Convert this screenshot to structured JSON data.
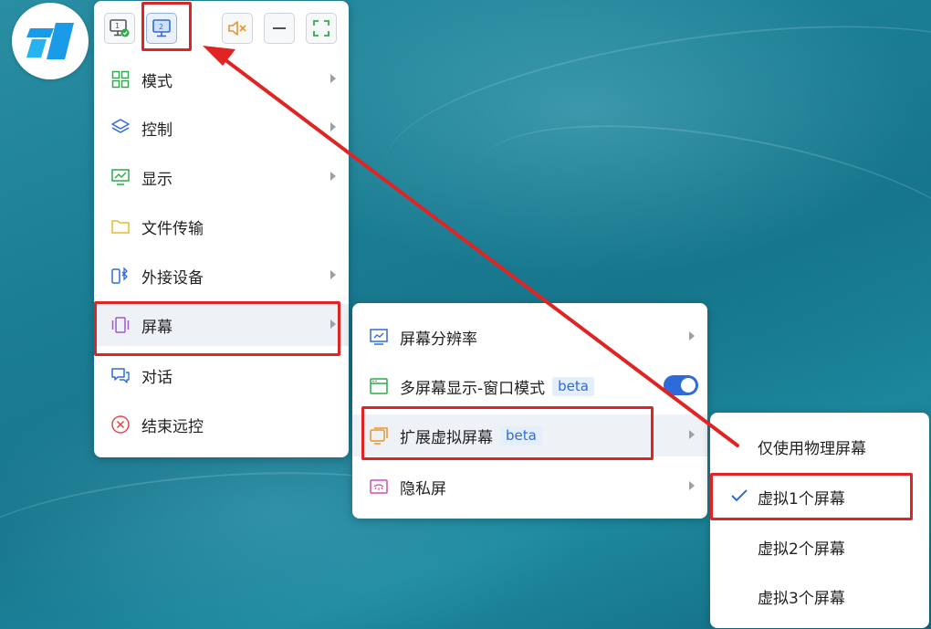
{
  "colors": {
    "accent": "#2f6bd8",
    "highlight": "#e02424",
    "toggle_on": "#2f6bd8"
  },
  "logo": {
    "icon": "todesk-logo-icon"
  },
  "toolbar": {
    "buttons": [
      {
        "name": "screen-1-button",
        "icon": "monitor-1-check-icon",
        "label": "1"
      },
      {
        "name": "screen-2-button",
        "icon": "monitor-2-icon",
        "label": "2"
      },
      {
        "name": "mute-button",
        "icon": "speaker-muted-icon"
      },
      {
        "name": "minimize-button",
        "icon": "minus-icon"
      },
      {
        "name": "fullscreen-button",
        "icon": "fullscreen-icon"
      }
    ]
  },
  "main_menu": {
    "items": [
      {
        "label": "模式",
        "icon": "grid-icon",
        "has_submenu": true
      },
      {
        "label": "控制",
        "icon": "layers-icon",
        "has_submenu": true
      },
      {
        "label": "显示",
        "icon": "monitor-chart-icon",
        "has_submenu": true
      },
      {
        "label": "文件传输",
        "icon": "folder-icon",
        "has_submenu": false
      },
      {
        "label": "外接设备",
        "icon": "bluetooth-device-icon",
        "has_submenu": true
      },
      {
        "label": "屏幕",
        "icon": "screens-icon",
        "has_submenu": true
      },
      {
        "label": "对话",
        "icon": "chat-icon",
        "has_submenu": false
      },
      {
        "label": "结束远控",
        "icon": "close-circle-icon",
        "has_submenu": false
      }
    ]
  },
  "screen_submenu": {
    "items": [
      {
        "label": "屏幕分辨率",
        "icon": "resolution-icon",
        "has_submenu": true
      },
      {
        "label": "多屏幕显示-窗口模式",
        "icon": "window-icon",
        "badge": "beta",
        "toggle_on": true
      },
      {
        "label": "扩展虚拟屏幕",
        "icon": "virtual-screen-icon",
        "badge": "beta",
        "has_submenu": true
      },
      {
        "label": "隐私屏",
        "icon": "privacy-screen-icon",
        "has_submenu": true
      }
    ]
  },
  "virtual_screen_submenu": {
    "items": [
      {
        "label": "仅使用物理屏幕",
        "checked": false
      },
      {
        "label": "虚拟1个屏幕",
        "checked": true
      },
      {
        "label": "虚拟2个屏幕",
        "checked": false
      },
      {
        "label": "虚拟3个屏幕",
        "checked": false
      }
    ]
  }
}
